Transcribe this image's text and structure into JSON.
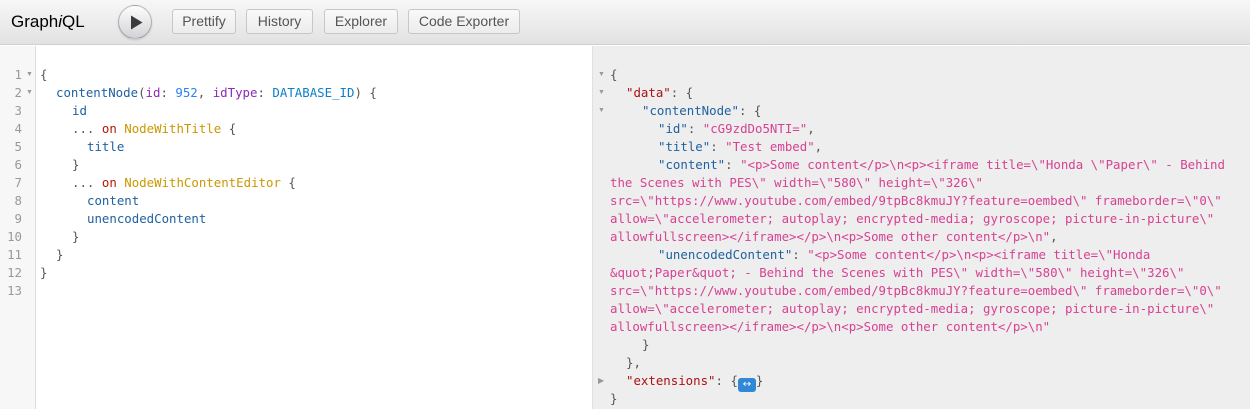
{
  "toolbar": {
    "logo_prefix": "Graph",
    "logo_italic": "i",
    "logo_suffix": "QL",
    "prettify_label": "Prettify",
    "history_label": "History",
    "explorer_label": "Explorer",
    "exporter_label": "Code Exporter"
  },
  "query": {
    "line_numbers": [
      "1",
      "2",
      "3",
      "4",
      "5",
      "6",
      "7",
      "8",
      "9",
      "10",
      "11",
      "12",
      "13"
    ],
    "l1_open": "{",
    "l2_field": "contentNode",
    "l2_paren_open": "(",
    "l2_arg1": "id",
    "l2_colon1": ":",
    "l2_val1": "952",
    "l2_comma": ",",
    "l2_arg2": "idType",
    "l2_colon2": ":",
    "l2_val2": "DATABASE_ID",
    "l2_paren_close": ")",
    "l2_brace": "{",
    "l3_field": "id",
    "l4_spread": "...",
    "l4_on": "on",
    "l4_type": "NodeWithTitle",
    "l4_brace": "{",
    "l5_field": "title",
    "l6_close": "}",
    "l7_spread": "...",
    "l7_on": "on",
    "l7_type": "NodeWithContentEditor",
    "l7_brace": "{",
    "l8_field": "content",
    "l9_field": "unencodedContent",
    "l10_close": "}",
    "l11_close": "}",
    "l12_close": "}"
  },
  "result": {
    "r1": "{",
    "r2_key": "\"data\"",
    "r2_rest": ": {",
    "r3_key": "\"contentNode\"",
    "r3_rest": ": {",
    "r4_key": "\"id\"",
    "r4_sep": ": ",
    "r4_val": "\"cG9zdDo5NTI=\"",
    "r4_comma": ",",
    "r5_key": "\"title\"",
    "r5_sep": ": ",
    "r5_val": "\"Test embed\"",
    "r5_comma": ",",
    "r6_key": "\"content\"",
    "r6_sep": ": ",
    "r6_val": "\"<p>Some content</p>\\n<p><iframe title=\\\"Honda \\\"Paper\\\" - Behind",
    "r7_val": "the Scenes with PES\\\" width=\\\"580\\\" height=\\\"326\\\"",
    "r8_val": "src=\\\"https://www.youtube.com/embed/9tpBc8kmuJY?feature=oembed\\\" frameborder=\\\"0\\\"",
    "r9_val": "allow=\\\"accelerometer; autoplay; encrypted-media; gyroscope; picture-in-picture\\\"",
    "r10_val": "allowfullscreen></iframe></p>\\n<p>Some other content</p>\\n\"",
    "r10_comma": ",",
    "r11_key": "\"unencodedContent\"",
    "r11_sep": ": ",
    "r11_val": "\"<p>Some content</p>\\n<p><iframe title=\\\"Honda",
    "r12_val": "&quot;Paper&quot; - Behind the Scenes with PES\\\" width=\\\"580\\\" height=\\\"326\\\"",
    "r13_val": "src=\\\"https://www.youtube.com/embed/9tpBc8kmuJY?feature=oembed\\\" frameborder=\\\"0\\\"",
    "r14_val": "allow=\\\"accelerometer; autoplay; encrypted-media; gyroscope; picture-in-picture\\\"",
    "r15_val": "allowfullscreen></iframe></p>\\n<p>Some other content</p>\\n\"",
    "r16": "}",
    "r17": "},",
    "r18_key": "\"extensions\"",
    "r18_sep": ": {",
    "r18_collapsed": "↔",
    "r18_close": "}",
    "r19": "}"
  }
}
